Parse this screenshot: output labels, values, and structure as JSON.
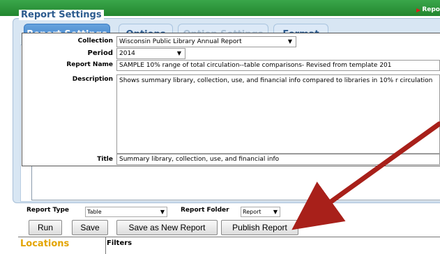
{
  "header": {
    "breadcrumb": "Repo"
  },
  "tabs": [
    {
      "label": "Report Settings",
      "state": "active"
    },
    {
      "label": "Options",
      "state": "normal"
    },
    {
      "label": "Option Settings",
      "state": "disabled"
    },
    {
      "label": "Format",
      "state": "normal"
    }
  ],
  "section": {
    "legend": "Report Settings"
  },
  "form": {
    "collection_label": "Collection",
    "collection_value": "Wisconsin Public Library Annual Report",
    "period_label": "Period",
    "period_value": "2014",
    "report_name_label": "Report Name",
    "report_name_value": "SAMPLE 10% range of total circulation--table comparisons- Revised from template 201",
    "description_label": "Description",
    "description_value": "Shows summary library, collection, use, and financial  info compared to libraries in 10% r circulation",
    "title_label": "Title",
    "title_value": "Summary library, collection, use, and financial  info"
  },
  "bottom": {
    "report_type_label": "Report Type",
    "report_type_value": "Table",
    "report_folder_label": "Report Folder",
    "report_folder_value": "Report",
    "buttons": {
      "run": "Run",
      "save": "Save",
      "save_new": "Save as New Report",
      "publish": "Publish Report"
    },
    "locations_label": "Locations",
    "filters_label": "Filters"
  },
  "colors": {
    "top_bar": "#2a8f36",
    "tab_active": "#4a8ccf",
    "annotation_arrow": "#a8201a",
    "locations_text": "#e3a400"
  }
}
